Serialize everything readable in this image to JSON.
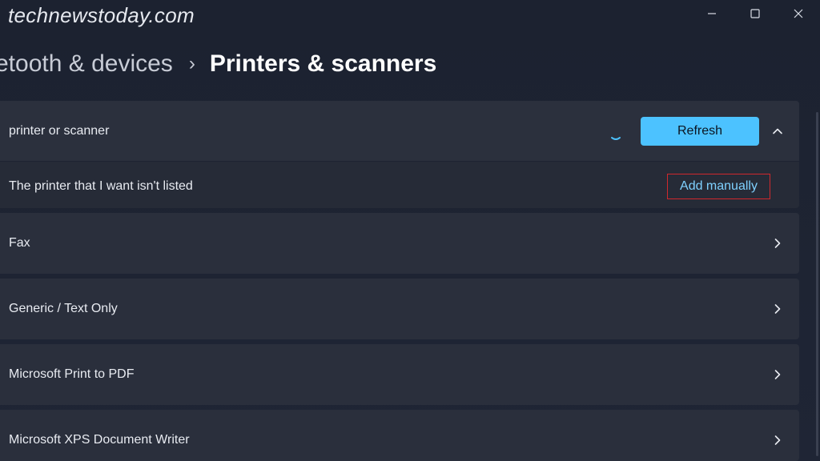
{
  "watermark": "technewstoday.com",
  "window_controls": {
    "minimize": "minimize-icon",
    "maximize": "maximize-icon",
    "close": "close-icon"
  },
  "breadcrumb": {
    "parent": "etooth & devices",
    "separator": "›",
    "current": "Printers & scanners"
  },
  "add_device": {
    "label": "printer or scanner",
    "refresh_label": "Refresh",
    "not_listed_label": "The printer that I want isn't listed",
    "add_manually_label": "Add manually"
  },
  "devices": [
    {
      "name": "Fax"
    },
    {
      "name": "Generic / Text Only"
    },
    {
      "name": "Microsoft Print to PDF"
    },
    {
      "name": "Microsoft XPS Document Writer"
    }
  ],
  "colors": {
    "accent": "#4cc2ff",
    "highlight_box": "#d0282d",
    "link": "#7fd1ff",
    "background": "#1f2535",
    "card": "#2a2f3c"
  }
}
